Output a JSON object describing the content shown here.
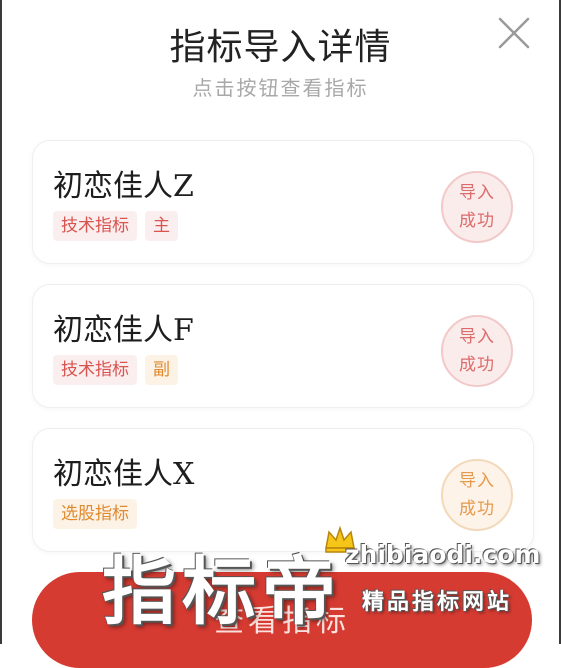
{
  "header": {
    "title": "指标导入详情",
    "subtitle": "点击按钮查看指标"
  },
  "items": [
    {
      "name": "初恋佳人Z",
      "tags": [
        "技术指标",
        "主"
      ],
      "status": [
        "导入",
        "成功"
      ],
      "color": "#d9534f"
    },
    {
      "name": "初恋佳人F",
      "tags": [
        "技术指标",
        "副"
      ],
      "status": [
        "导入",
        "成功"
      ],
      "color": "#d9534f"
    },
    {
      "name": "初恋佳人X",
      "tags": [
        "选股指标"
      ],
      "status": [
        "导入",
        "成功"
      ],
      "color": "#e08a2e"
    }
  ],
  "action": {
    "label": "查看指标"
  },
  "watermark": {
    "brand": "指标帝",
    "url": "zhibiaodi.com",
    "slogan": "精品指标网站"
  },
  "colors": {
    "accent": "#d63b32",
    "tag_red": "#d9534f",
    "tag_orange": "#e08a2e"
  }
}
